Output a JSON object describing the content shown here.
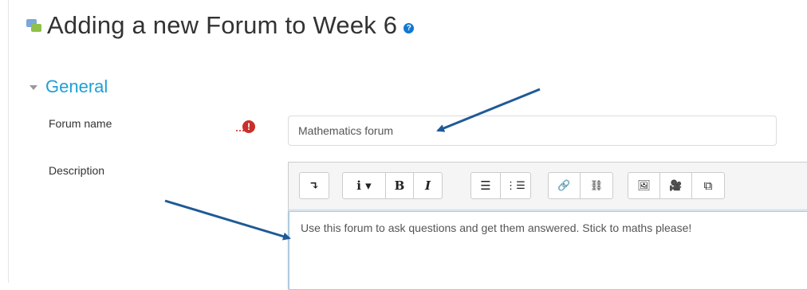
{
  "page": {
    "title": "Adding a new Forum to Week 6",
    "title_icon": "forum-icon",
    "help_icon": "help-icon"
  },
  "section": {
    "title": "General",
    "collapsed": false
  },
  "fields": {
    "forum_name": {
      "label": "Forum name",
      "required": true,
      "required_icon": "exclamation-icon",
      "value": "Mathematics forum"
    },
    "description": {
      "label": "Description",
      "value": "Use this forum to ask questions and get them answered. Stick to maths please!"
    }
  },
  "toolbar": {
    "show_more_label": "↴",
    "paragraph_label": "i ▾",
    "bold_label": "B",
    "italic_label": "I",
    "unordered_list_label": "☰",
    "ordered_list_label": "⋮☰",
    "link_label": "🔗",
    "unlink_label": "⛓",
    "image_label": "🖼",
    "media_label": "🎥",
    "manage_files_label": "⧉"
  },
  "colors": {
    "accent": "#1da0d6",
    "help": "#1177d1",
    "required": "#c9302c",
    "annotation_arrow": "#1f5a96"
  }
}
